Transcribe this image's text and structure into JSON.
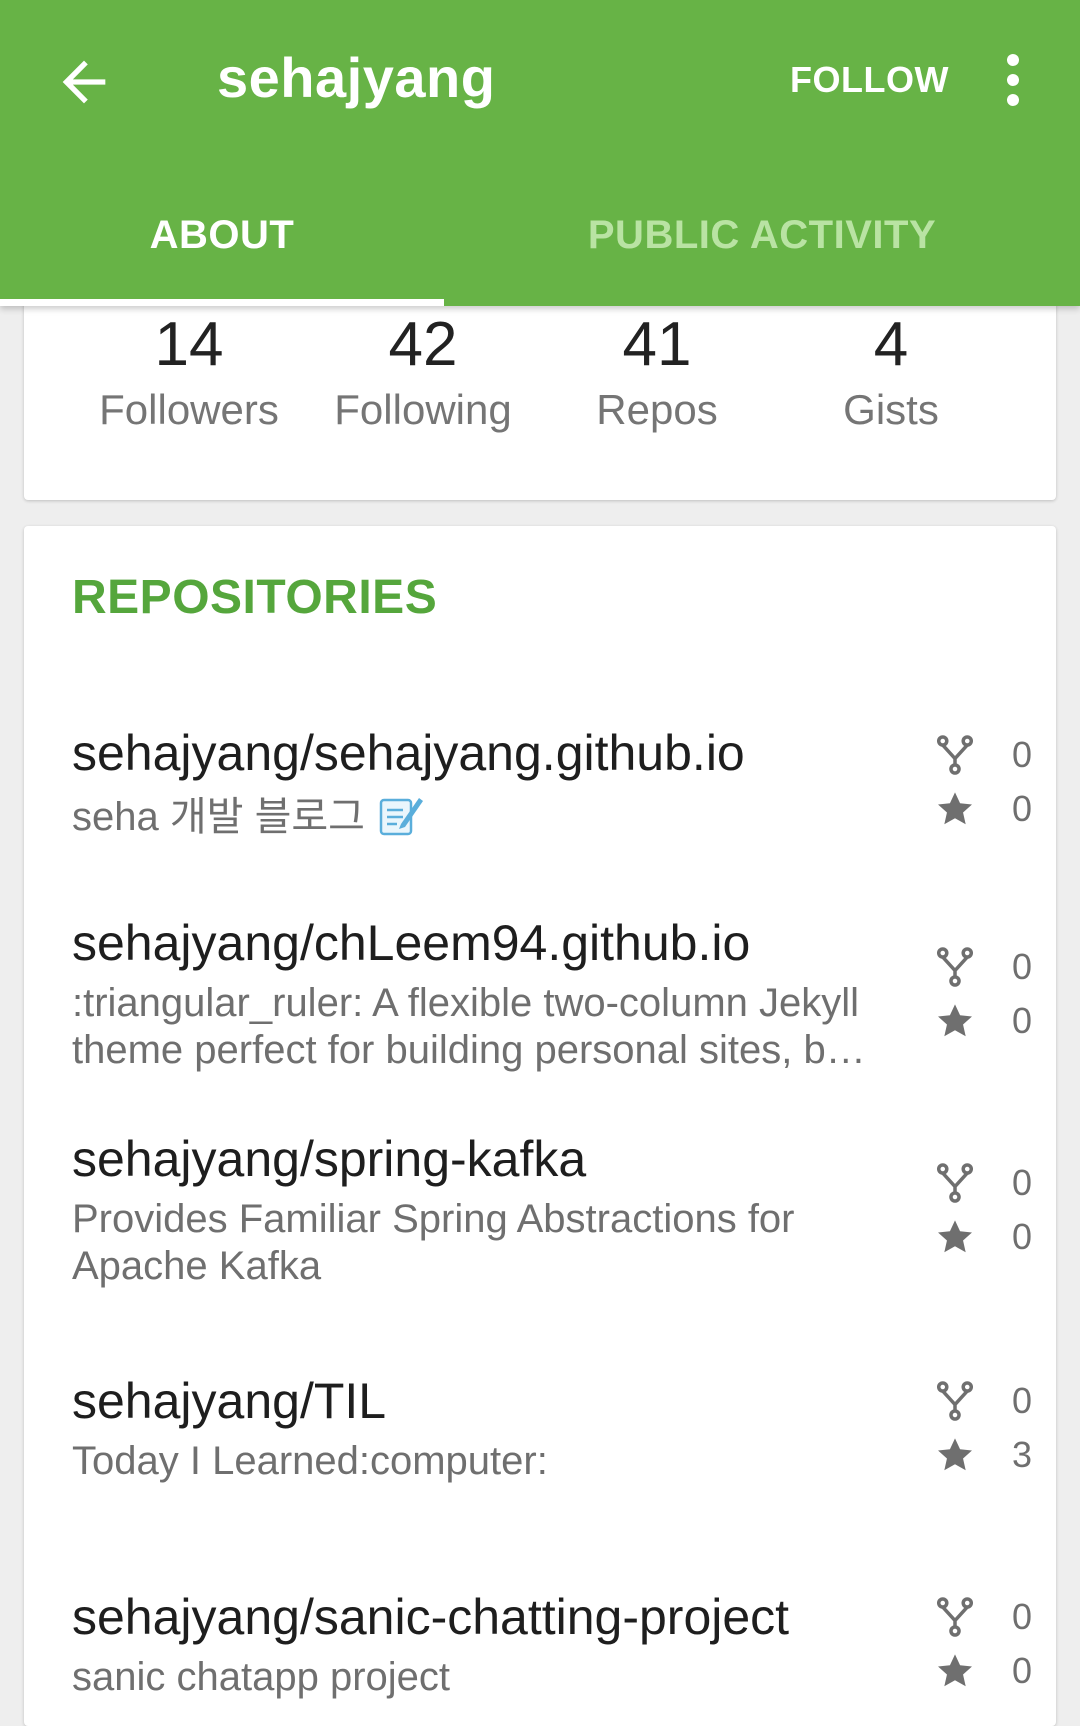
{
  "appbar": {
    "title": "sehajyang",
    "follow_label": "FOLLOW",
    "background": "#67b346"
  },
  "tabs": [
    {
      "label": "ABOUT",
      "selected": true
    },
    {
      "label": "PUBLIC ACTIVITY",
      "selected": false
    }
  ],
  "stats": [
    {
      "count": "14",
      "label": "Followers"
    },
    {
      "count": "42",
      "label": "Following"
    },
    {
      "count": "41",
      "label": "Repos"
    },
    {
      "count": "4",
      "label": "Gists"
    }
  ],
  "repositories": {
    "heading": "REPOSITORIES",
    "heading_color": "#55a63c",
    "items": [
      {
        "name": "sehajyang/sehajyang.github.io",
        "description": "seha 개발 블로그",
        "forks": "0",
        "stars": "0"
      },
      {
        "name": "sehajyang/chLeem94.github.io",
        "description": ":triangular_ruler: A flexible two-column Jekyll theme perfect for building personal sites, b…",
        "forks": "0",
        "stars": "0"
      },
      {
        "name": "sehajyang/spring-kafka",
        "description": "Provides Familiar Spring Abstractions for Apache Kafka",
        "forks": "0",
        "stars": "0"
      },
      {
        "name": "sehajyang/TIL",
        "description": "Today I Learned:computer:",
        "forks": "0",
        "stars": "3"
      },
      {
        "name": "sehajyang/sanic-chatting-project",
        "description": "sanic chatapp project",
        "forks": "0",
        "stars": "0"
      }
    ]
  }
}
